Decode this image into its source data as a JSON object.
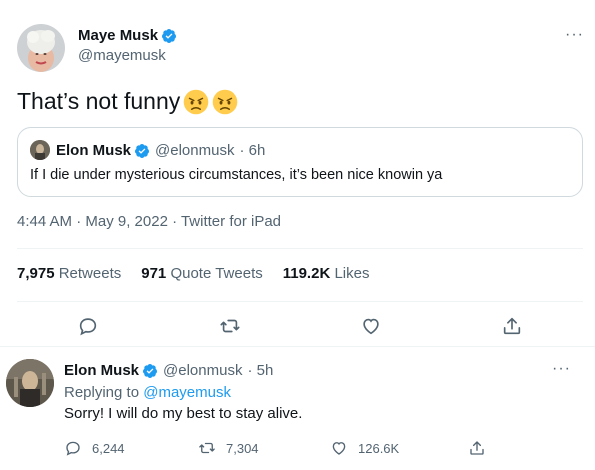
{
  "main_tweet": {
    "author": {
      "display_name": "Maye Musk",
      "handle": "@mayemusk"
    },
    "more_label": "···",
    "text": "That’s not funny",
    "emojis": [
      "angry-face",
      "angry-face"
    ],
    "quoted": {
      "display_name": "Elon Musk",
      "handle": "@elonmusk",
      "time": "· 6h",
      "text": "If I die under mysterious circumstances, it’s been nice knowin ya"
    },
    "meta": "4:44 AM · May 9, 2022 · Twitter for iPad",
    "stats": {
      "retweets_count": "7,975",
      "retweets_label": "Retweets",
      "quotes_count": "971",
      "quotes_label": "Quote Tweets",
      "likes_count": "119.2K",
      "likes_label": "Likes"
    },
    "actions": [
      "reply-icon",
      "retweet-icon",
      "like-icon",
      "share-icon"
    ]
  },
  "reply_tweet": {
    "author": {
      "display_name": "Elon Musk",
      "handle": "@elonmusk",
      "time": "· 5h"
    },
    "more_label": "···",
    "replying_prefix": "Replying to",
    "replying_to": "@mayemusk",
    "text": "Sorry! I will do my best to stay alive.",
    "counts": {
      "replies": "6,244",
      "retweets": "7,304",
      "likes": "126.6K"
    }
  },
  "colors": {
    "accent": "#1d9bf0",
    "secondary_text": "#536471",
    "primary_text": "#0f1419",
    "border": "#cfd9de"
  }
}
